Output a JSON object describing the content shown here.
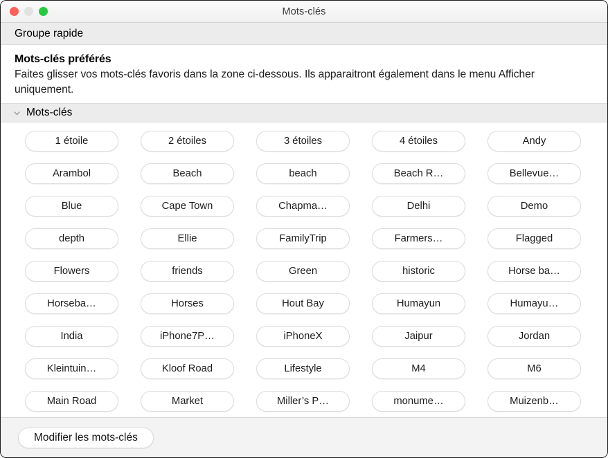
{
  "window": {
    "title": "Mots-clés",
    "traffic_lights": [
      {
        "name": "close",
        "color": "#ff5f57"
      },
      {
        "name": "minimize",
        "color": "#e2e2e2"
      },
      {
        "name": "zoom",
        "color": "#28c840"
      }
    ]
  },
  "quick_group": {
    "label": "Groupe rapide"
  },
  "intro": {
    "title": "Mots-clés préférés",
    "description": "Faites glisser vos mots-clés favoris dans la zone ci-dessous. Ils apparaitront également dans le menu Afficher uniquement."
  },
  "disclosure": {
    "icon": "chevron-down-icon",
    "label": "Mots-clés",
    "expanded": true
  },
  "keywords": {
    "columns": 5,
    "rows": [
      [
        "1 étoile",
        "2 étoiles",
        "3 étoiles",
        "4 étoiles",
        "Andy"
      ],
      [
        "Arambol",
        "Beach",
        "beach",
        "Beach R…",
        "Bellevue…"
      ],
      [
        "Blue",
        "Cape Town",
        "Chapma…",
        "Delhi",
        "Demo"
      ],
      [
        "depth",
        "Ellie",
        "FamilyTrip",
        "Farmers…",
        "Flagged"
      ],
      [
        "Flowers",
        "friends",
        "Green",
        "historic",
        "Horse ba…"
      ],
      [
        "Horseba…",
        "Horses",
        "Hout Bay",
        "Humayun",
        "Humayu…"
      ],
      [
        "India",
        "iPhone7P…",
        "iPhoneX",
        "Jaipur",
        "Jordan"
      ],
      [
        "Kleintuin…",
        "Kloof Road",
        "Lifestyle",
        "M4",
        "M6"
      ],
      [
        "Main Road",
        "Market",
        "Miller’s P…",
        "monume…",
        "Muizenb…"
      ]
    ],
    "flat": [
      "1 étoile",
      "2 étoiles",
      "3 étoiles",
      "4 étoiles",
      "Andy",
      "Arambol",
      "Beach",
      "beach",
      "Beach R…",
      "Bellevue…",
      "Blue",
      "Cape Town",
      "Chapma…",
      "Delhi",
      "Demo",
      "depth",
      "Ellie",
      "FamilyTrip",
      "Farmers…",
      "Flagged",
      "Flowers",
      "friends",
      "Green",
      "historic",
      "Horse ba…",
      "Horseba…",
      "Horses",
      "Hout Bay",
      "Humayun",
      "Humayu…",
      "India",
      "iPhone7P…",
      "iPhoneX",
      "Jaipur",
      "Jordan",
      "Kleintuin…",
      "Kloof Road",
      "Lifestyle",
      "M4",
      "M6",
      "Main Road",
      "Market",
      "Miller’s P…",
      "monume…",
      "Muizenb…"
    ]
  },
  "footer": {
    "edit_keywords_label": "Modifier les mots-clés"
  },
  "colors": {
    "window_background": "#ffffff",
    "band_background": "#ececec",
    "bottom_bar_background": "#f3f3f3",
    "chip_border": "#dcdcdc",
    "text": "#1c1c1c"
  }
}
